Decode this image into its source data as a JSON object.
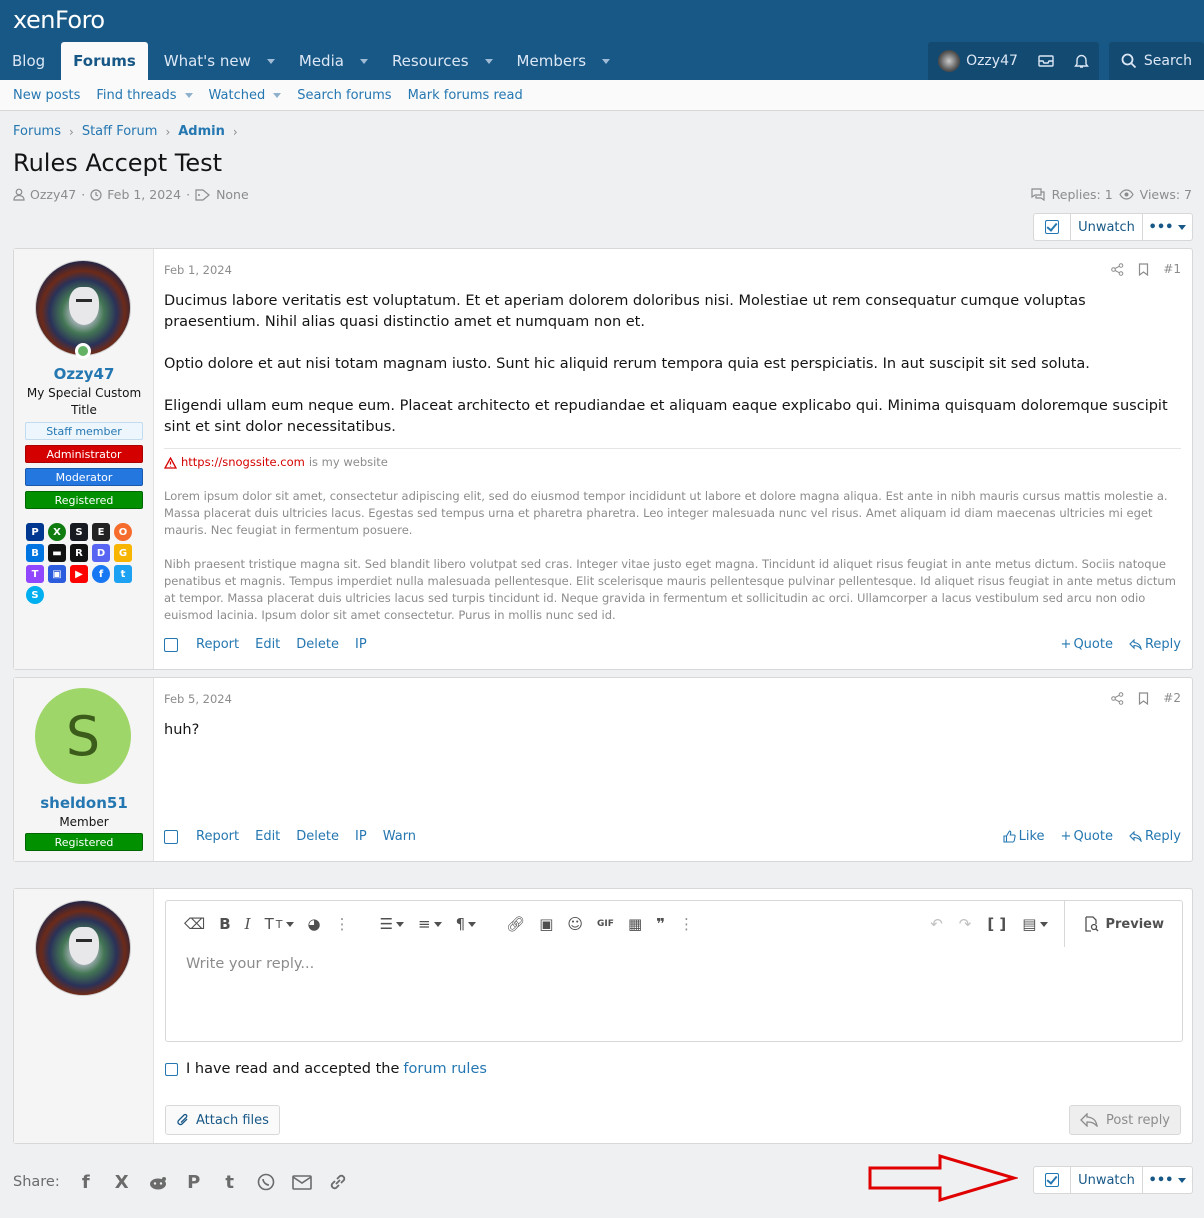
{
  "header": {
    "logo": "xenForo",
    "nav": [
      {
        "label": "Blog",
        "active": false,
        "dropdown": false
      },
      {
        "label": "Forums",
        "active": true,
        "dropdown": false
      },
      {
        "label": "What's new",
        "active": false,
        "dropdown": true
      },
      {
        "label": "Media",
        "active": false,
        "dropdown": true
      },
      {
        "label": "Resources",
        "active": false,
        "dropdown": true
      },
      {
        "label": "Members",
        "active": false,
        "dropdown": true
      }
    ],
    "account_name": "Ozzy47",
    "search_label": "Search"
  },
  "subnav": [
    "New posts",
    "Find threads",
    "Watched",
    "Search forums",
    "Mark forums read"
  ],
  "breadcrumb": [
    "Forums",
    "Staff Forum",
    "Admin"
  ],
  "thread": {
    "title": "Rules Accept Test",
    "author": "Ozzy47",
    "date": "Feb 1, 2024",
    "tags": "None",
    "replies": "Replies: 1",
    "views": "Views: 7",
    "unwatch_label": "Unwatch"
  },
  "posts": [
    {
      "username": "Ozzy47",
      "user_title": "My Special Custom Title",
      "banners": [
        "Staff member",
        "Administrator",
        "Moderator",
        "Registered"
      ],
      "date": "Feb 1, 2024",
      "number": "#1",
      "paragraphs": [
        "Ducimus labore veritatis est voluptatum. Et et aperiam dolorem doloribus nisi. Molestiae ut rem consequatur cumque voluptas praesentium. Nihil alias quasi distinctio amet et numquam non et.",
        "Optio dolore et aut nisi totam magnam iusto. Sunt hic aliquid rerum tempora quia est perspiciatis. In aut suscipit sit sed soluta.",
        "Eligendi ullam eum neque eum. Placeat architecto et repudiandae et aliquam eaque explicabo qui. Minima quisquam doloremque suscipit sint et sint dolor necessitatibus."
      ],
      "signature": {
        "link": "https://snogssite.com",
        "link_suffix": "is my website",
        "p1": "Lorem ipsum dolor sit amet, consectetur adipiscing elit, sed do eiusmod tempor incididunt ut labore et dolore magna aliqua. Est ante in nibh mauris cursus mattis molestie a. Massa placerat duis ultricies lacus. Egestas sed tempus urna et pharetra pharetra. Leo integer malesuada nunc vel risus. Amet aliquam id diam maecenas ultricies mi eget mauris. Nec feugiat in fermentum posuere.",
        "p2": "Nibh praesent tristique magna sit. Sed blandit libero volutpat sed cras. Integer vitae justo eget magna. Tincidunt id aliquet risus feugiat in ante metus dictum. Sociis natoque penatibus et magnis. Tempus imperdiet nulla malesuada pellentesque. Elit scelerisque mauris pellentesque pulvinar pellentesque. Id aliquet risus feugiat in ante metus dictum at tempor. Massa placerat duis ultricies lacus sed turpis tincidunt id. Neque gravida in fermentum et sollicitudin ac orci. Ullamcorper a lacus vestibulum sed arcu non odio euismod lacinia. Ipsum dolor sit amet consectetur. Purus in mollis nunc sed id."
      },
      "actions_left": [
        "Report",
        "Edit",
        "Delete",
        "IP"
      ],
      "actions_right": [
        "Quote",
        "Reply"
      ]
    },
    {
      "username": "sheldon51",
      "avatar_letter": "S",
      "user_title": "Member",
      "banners": [
        "Registered"
      ],
      "date": "Feb 5, 2024",
      "number": "#2",
      "paragraphs": [
        "huh?"
      ],
      "actions_left": [
        "Report",
        "Edit",
        "Delete",
        "IP",
        "Warn"
      ],
      "actions_right": [
        "Like",
        "Quote",
        "Reply"
      ]
    }
  ],
  "reply": {
    "placeholder": "Write your reply...",
    "preview_label": "Preview",
    "accept_text": "I have read and accepted the",
    "accept_link": "forum rules",
    "attach_label": "Attach files",
    "post_label": "Post reply"
  },
  "share": {
    "label": "Share:"
  },
  "colors": {
    "header": "#185886",
    "link": "#2577b1",
    "admin_banner": "#d40000",
    "mod_banner": "#2577e0",
    "registered_banner": "#009000",
    "annotation_arrow": "#e00000"
  }
}
